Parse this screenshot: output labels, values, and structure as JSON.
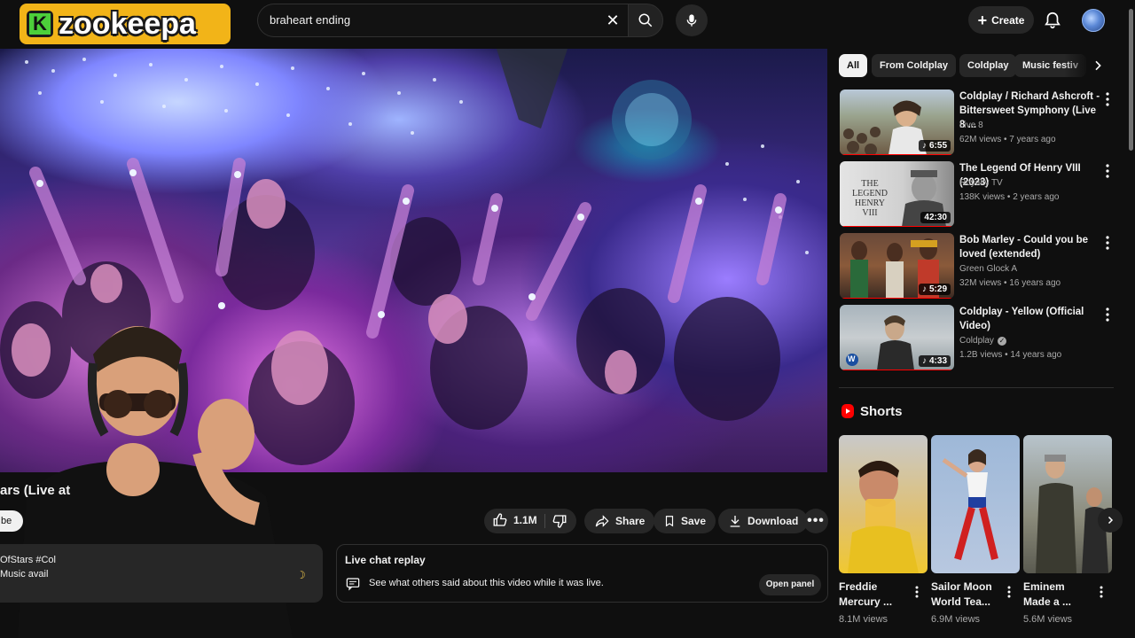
{
  "header": {
    "logo_text": "zookeepa",
    "logo_mark": "K",
    "search_value": "braheart ending",
    "create_label": "Create"
  },
  "video": {
    "title_fragment": "ars (Live at ",
    "subscribe_fragment": "be"
  },
  "actions": {
    "like_count": "1.1M",
    "share_label": "Share",
    "save_label": "Save",
    "download_label": "Download"
  },
  "description": {
    "line1": "OfStars #Col",
    "line2": "Music avail"
  },
  "live_chat": {
    "title": "Live chat replay",
    "text": "See what others said about this video while it was live.",
    "button": "Open panel"
  },
  "chips": [
    "All",
    "From Coldplay",
    "Coldplay",
    "Music festiv"
  ],
  "recommendations": [
    {
      "title": "Coldplay / Richard Ashcroft - Bittersweet Symphony (Live 8 ...",
      "channel": "Live 8",
      "meta": "62M views • 7 years ago",
      "duration": "6:55",
      "progress": 1.0
    },
    {
      "title": "The Legend Of Henry VIII (2023)",
      "channel": "Royalty TV",
      "meta": "138K views • 2 years ago",
      "duration": "42:30",
      "progress": 1.0
    },
    {
      "title": "Bob Marley - Could you be loved (extended)",
      "channel": "Green Glock A",
      "meta": "32M views • 16 years ago",
      "duration": "5:29",
      "progress": 1.0
    },
    {
      "title": "Coldplay - Yellow (Official Video)",
      "channel": "Coldplay",
      "meta": "1.2B views • 14 years ago",
      "duration": "4:33",
      "progress": 1.0
    }
  ],
  "thumb_text": {
    "henry": "THE LEGEND HENRY VIII"
  },
  "shorts": {
    "heading": "Shorts",
    "items": [
      {
        "title": "Freddie Mercury ...",
        "views": "8.1M views"
      },
      {
        "title": "Sailor Moon World Tea...",
        "views": "6.9M views"
      },
      {
        "title": "Eminem Made a ...",
        "views": "5.6M views"
      }
    ]
  },
  "colors": {
    "accent_red": "#ff0000",
    "background": "#0f0f0f",
    "logo_yellow": "#f2b418",
    "logo_green": "#4ccf3a"
  }
}
